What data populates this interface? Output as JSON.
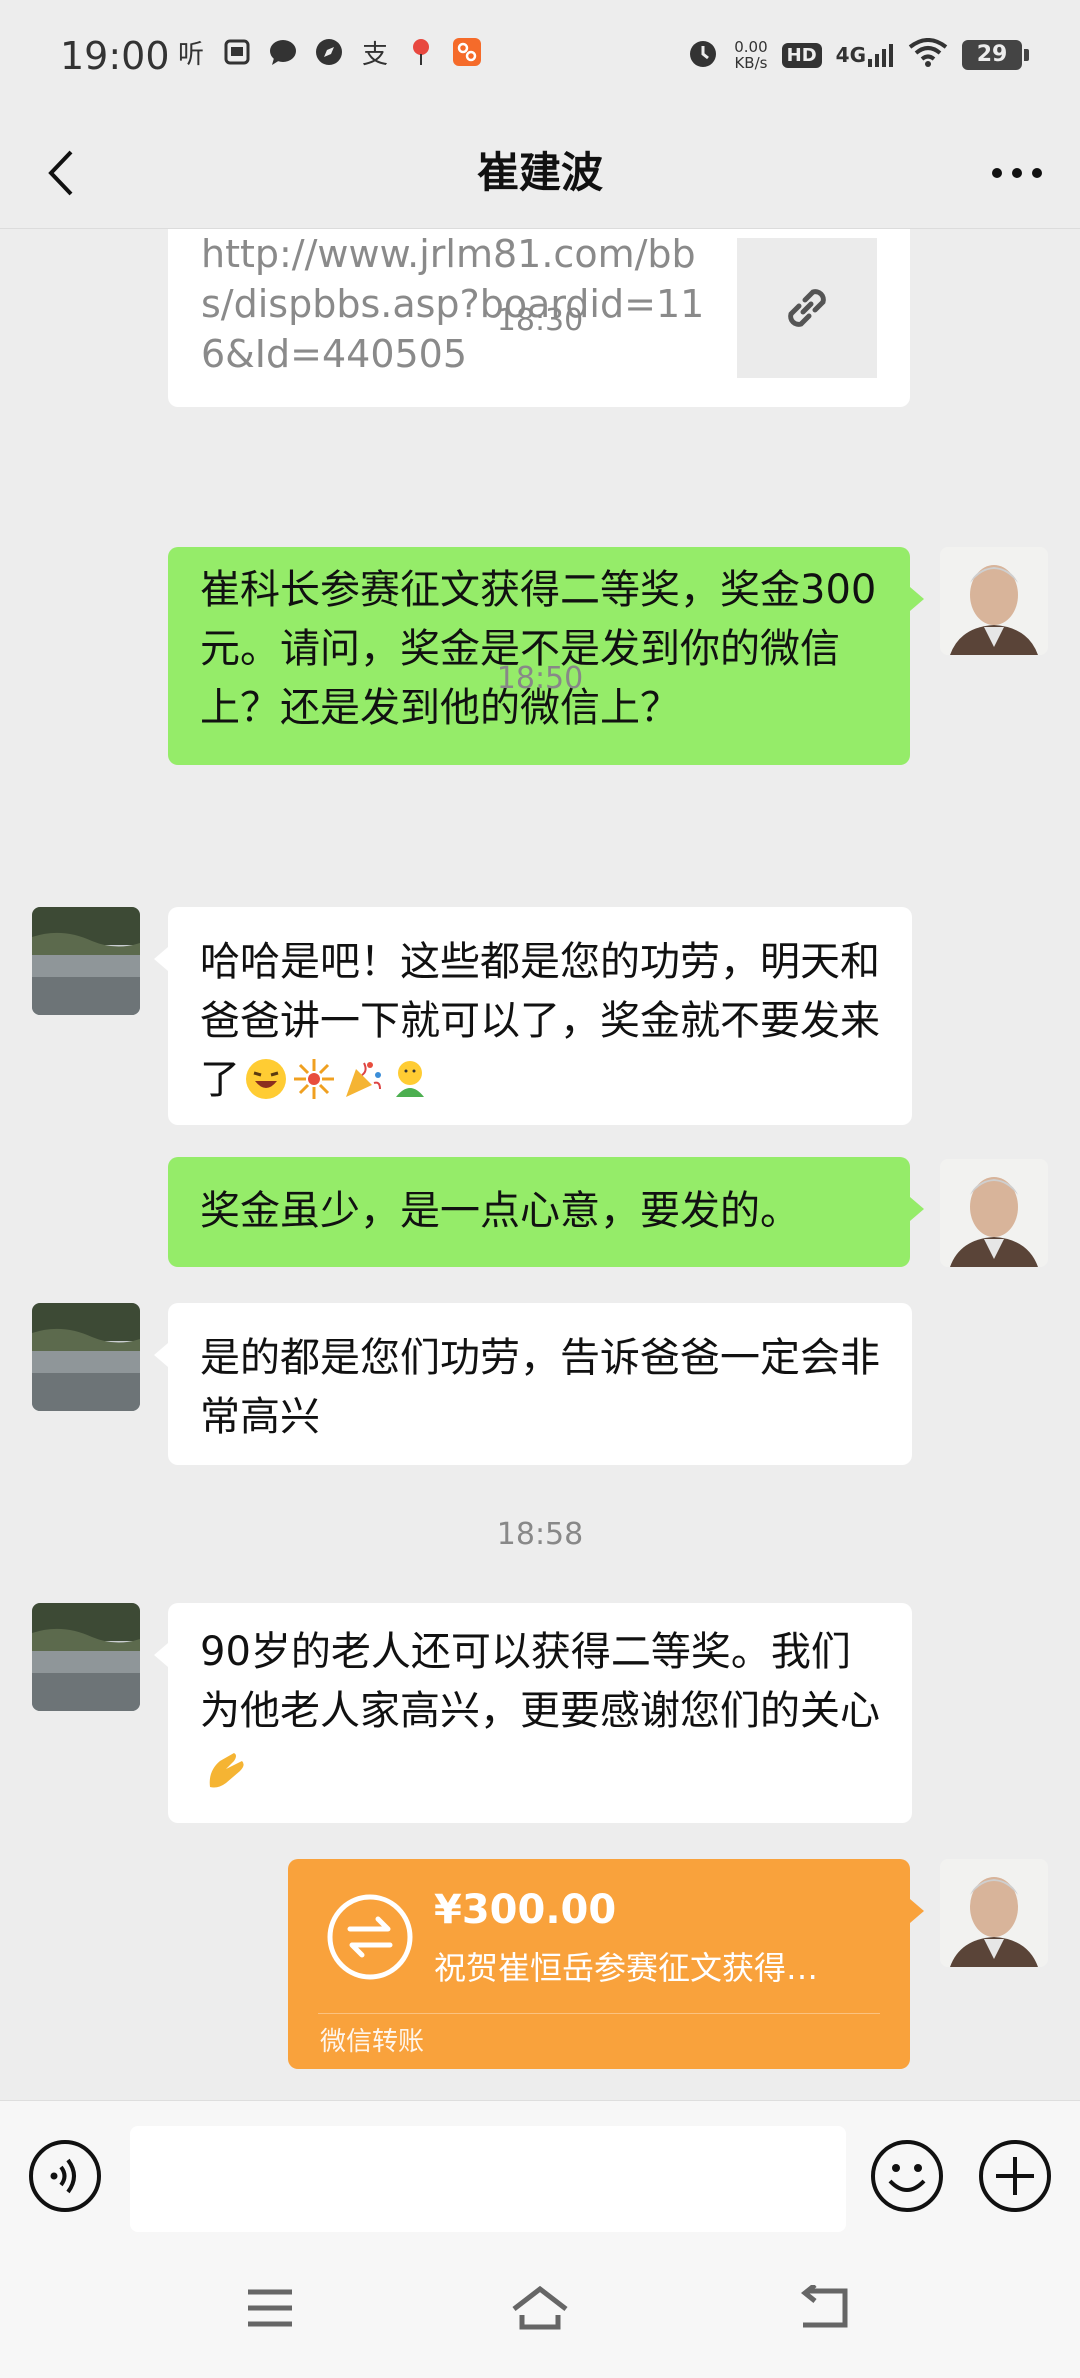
{
  "status_bar": {
    "time": "19:00",
    "network_speed_value": "0.00",
    "network_speed_unit": "KB/s",
    "hd_label": "HD",
    "signal_label": "4G",
    "battery": "29",
    "left_icons": [
      "listen-icon",
      "gallery-icon",
      "chat-icon",
      "compass-icon",
      "alipay-icon",
      "pin-icon",
      "app-icon"
    ]
  },
  "header": {
    "title": "崔建波"
  },
  "messages": {
    "link_card": {
      "url": "http://www.jrlm81.com/bbs/dispbbs.asp?boardid=116&Id=440505"
    },
    "time_1": "18:30",
    "msg_1": "崔科长参赛征文获得二等奖，奖金300元。请问，奖金是不是发到你的微信上？还是发到他的微信上？",
    "time_2": "18:50",
    "msg_2": "哈哈是吧！这些都是您的功劳，明天和爸爸讲一下就可以了，奖金就不要发来了",
    "msg_3": "奖金虽少，是一点心意，要发的。",
    "msg_4": "是的都是您们功劳，告诉爸爸一定会非常高兴",
    "time_3": "18:58",
    "msg_5": "90岁的老人还可以获得二等奖。我们为他老人家高兴，更要感谢您们的关心",
    "transfer": {
      "amount": "¥300.00",
      "description": "祝贺崔恒岳参赛征文获得…",
      "footer": "微信转账"
    }
  },
  "input_bar": {
    "placeholder": ""
  },
  "colors": {
    "background": "#ededed",
    "sent_bubble": "#95ec69",
    "received_bubble": "#ffffff",
    "transfer_card": "#f9a23c"
  }
}
